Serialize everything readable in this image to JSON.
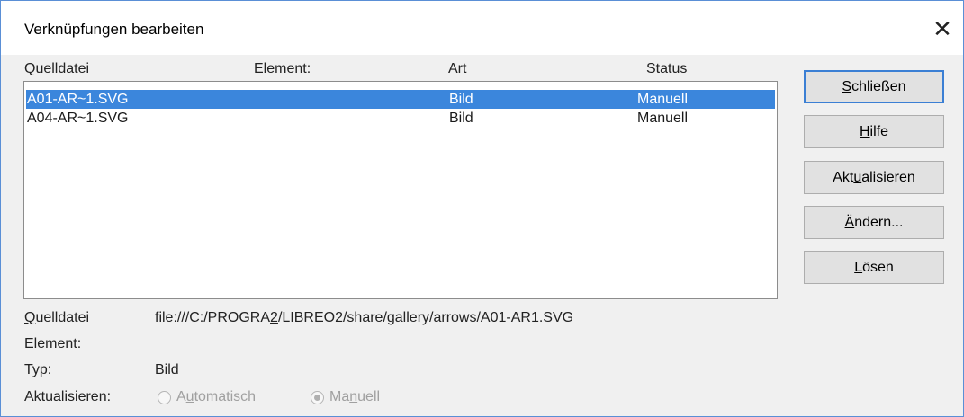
{
  "dialog": {
    "title": "Verknüpfungen bearbeiten",
    "close_glyph": "✕"
  },
  "list": {
    "headers": {
      "source": "Quelldatei",
      "element": "Element:",
      "type": "Art",
      "status": "Status"
    },
    "rows": [
      {
        "source": "A01-AR~1.SVG",
        "element": "",
        "type": "Bild",
        "status": "Manuell",
        "selected": true
      },
      {
        "source": "A04-AR~1.SVG",
        "element": "",
        "type": "Bild",
        "status": "Manuell",
        "selected": false
      }
    ]
  },
  "buttons": {
    "close": {
      "pre": "",
      "mnemonic": "S",
      "post": "chließen"
    },
    "help": {
      "pre": "",
      "mnemonic": "H",
      "post": "ilfe"
    },
    "update": {
      "pre": "Akt",
      "mnemonic": "u",
      "post": "alisieren"
    },
    "modify": {
      "pre": "",
      "mnemonic": "Ä",
      "post": "ndern..."
    },
    "break": {
      "pre": "",
      "mnemonic": "L",
      "post": "ösen"
    }
  },
  "details": {
    "source_label": {
      "mnemonic": "Q",
      "post": "uelldatei"
    },
    "source_value_pre": "file:///C:/PROGRA",
    "source_value_underlined": "2",
    "source_value_post": "/LIBREO2/share/gallery/arrows/A01-AR1.SVG",
    "element_label": "Element:",
    "element_value": "",
    "type_label": "Typ:",
    "type_value": "Bild",
    "update_label": "Aktualisieren:",
    "radio_auto": {
      "pre": "A",
      "mnemonic": "u",
      "post": "tomatisch",
      "checked": false
    },
    "radio_manual": {
      "pre": "Ma",
      "mnemonic": "n",
      "post": "uell",
      "checked": true
    }
  }
}
